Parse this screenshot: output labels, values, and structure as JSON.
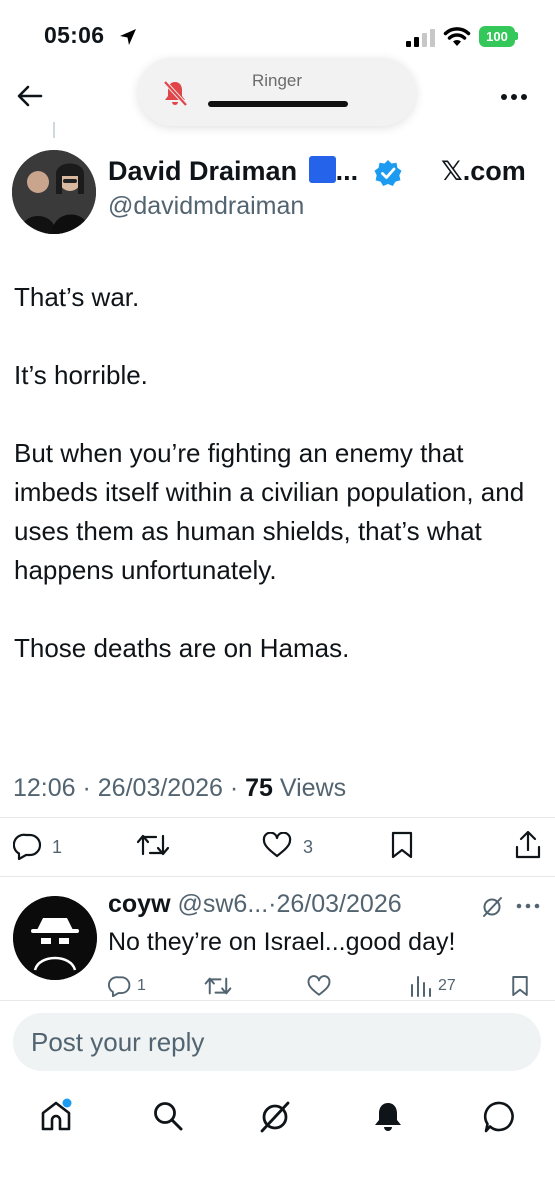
{
  "status_bar": {
    "time": "05:06",
    "battery": "100"
  },
  "ringer": {
    "label": "Ringer"
  },
  "tweet": {
    "author_name": "David Draiman",
    "author_flag": "🟦",
    "ellipsis": "...",
    "handle": "@davidmdraiman",
    "watermark": "𝕏.com",
    "paragraphs": [
      "That’s war.",
      "It’s horrible.",
      "But when you’re fighting an enemy that imbeds itself within a civilian population, and uses them as human shields, that’s what happens unfortunately.",
      "Those deaths are on Hamas."
    ],
    "time": "12:06",
    "date": "26/03/2026",
    "views_count": "75",
    "views_label": "Views",
    "replies": "1",
    "likes": "3"
  },
  "reply": {
    "name": "coyw",
    "handle": "@sw6...",
    "date": "26/03/2026",
    "text": "No they’re on Israel...good day!",
    "replies": "1",
    "views": "27"
  },
  "composer": {
    "placeholder": "Post your reply"
  },
  "colors": {
    "verified": "#1d9bf0",
    "battery": "#34c759",
    "text_primary": "#0f1419",
    "text_secondary": "#536471",
    "muted_red": "#e0454a"
  }
}
